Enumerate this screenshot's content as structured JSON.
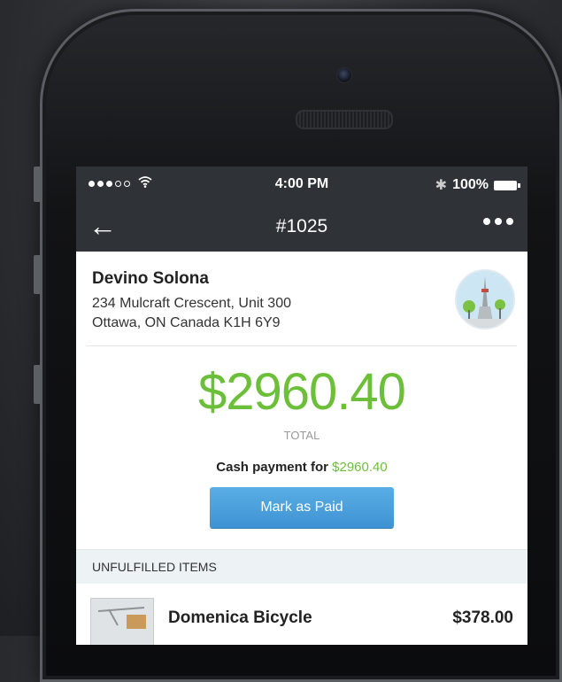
{
  "status_bar": {
    "time": "4:00 PM",
    "battery": "100%",
    "signal_icon": "signal-dots-icon",
    "wifi_icon": "wifi-icon",
    "bluetooth_icon": "bluetooth-icon"
  },
  "navbar": {
    "title": "#1025",
    "back_icon": "back-arrow-icon",
    "more_icon": "more-dots-icon"
  },
  "customer": {
    "name": "Devino Solona",
    "address_line1": "234 Mulcraft Crescent, Unit 300",
    "address_line2": "Ottawa, ON Canada K1H 6Y9"
  },
  "payment": {
    "total_amount": "$2960.40",
    "total_label": "TOTAL",
    "cash_prefix": "Cash payment for",
    "cash_amount": "$2960.40",
    "mark_paid_label": "Mark as Paid"
  },
  "unfulfilled": {
    "header": "UNFULFILLED ITEMS",
    "items": [
      {
        "name": "Domenica Bicycle",
        "price": "$378.00"
      }
    ]
  },
  "colors": {
    "accent_green": "#6cbf38",
    "button_blue": "#4a9fdb",
    "bar_dark": "#2f3236"
  }
}
